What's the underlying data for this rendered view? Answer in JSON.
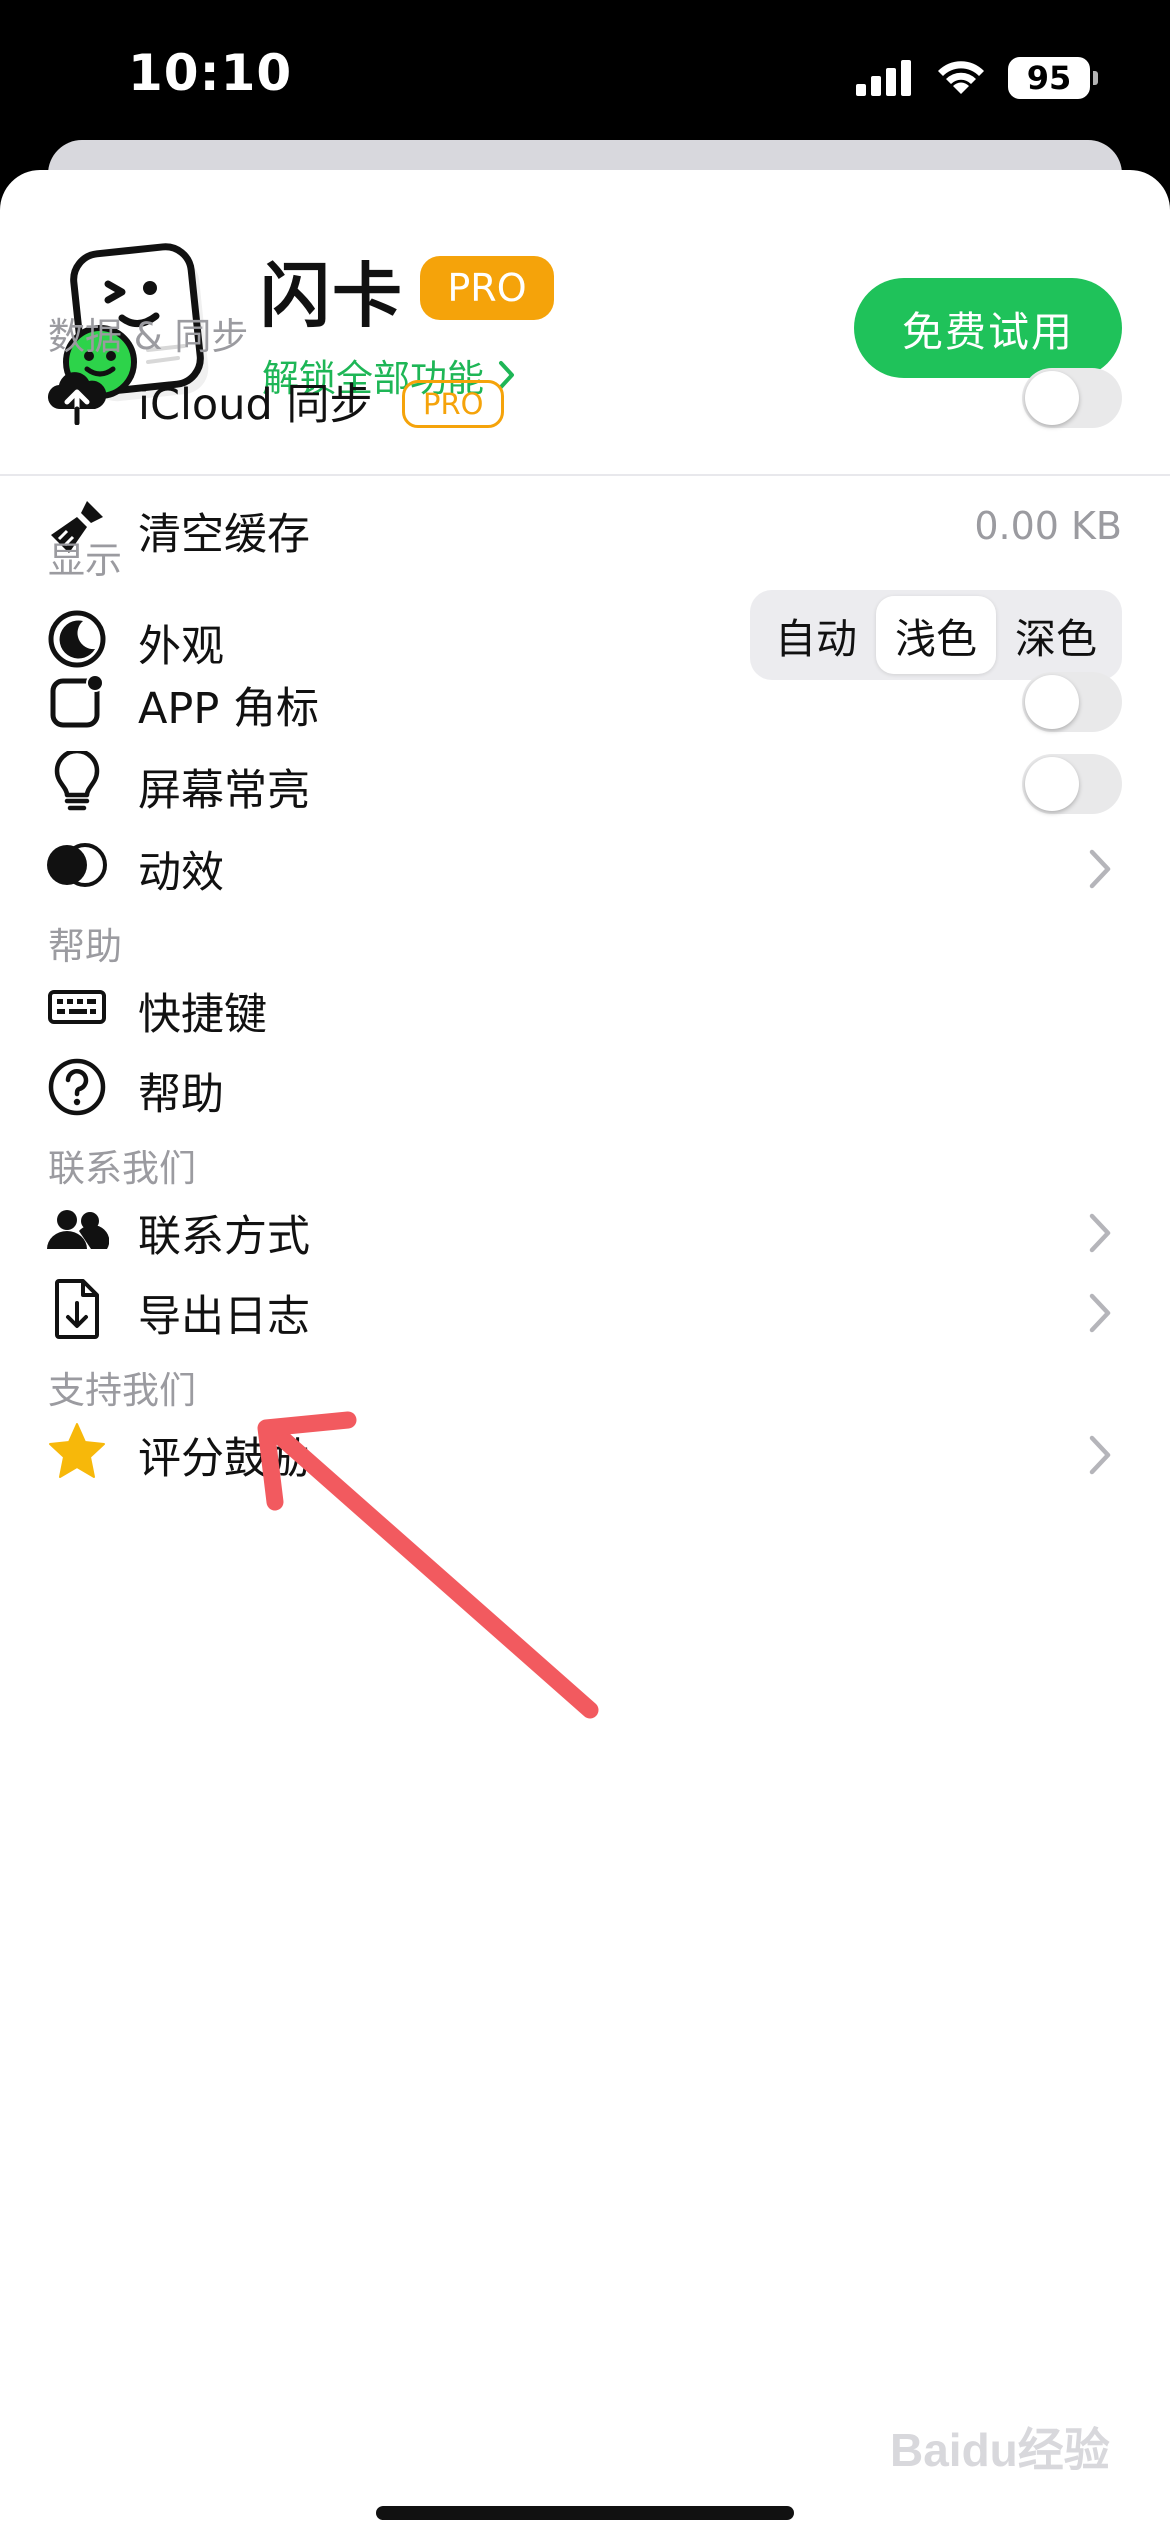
{
  "status_bar": {
    "time": "10:10",
    "battery": "95"
  },
  "header": {
    "app_name": "闪卡",
    "pro_badge": "PRO",
    "unlock_link": "解锁全部功能",
    "trial_button": "免费试用"
  },
  "sections": {
    "data_sync": {
      "title": "数据 & 同步",
      "icloud": {
        "label": "iCloud 同步",
        "badge": "PRO"
      },
      "clear_cache": {
        "label": "清空缓存",
        "value": "0.00 KB"
      }
    },
    "display": {
      "title": "显示",
      "appearance": {
        "label": "外观",
        "options": [
          "自动",
          "浅色",
          "深色"
        ],
        "selected": "浅色"
      },
      "app_badge": {
        "label": "APP 角标"
      },
      "keep_screen_on": {
        "label": "屏幕常亮"
      },
      "animation": {
        "label": "动效"
      }
    },
    "help": {
      "title": "帮助",
      "shortcuts": {
        "label": "快捷键"
      },
      "help": {
        "label": "帮助"
      }
    },
    "contact": {
      "title": "联系我们",
      "contact_methods": {
        "label": "联系方式"
      },
      "export_logs": {
        "label": "导出日志"
      }
    },
    "support": {
      "title": "支持我们",
      "rate": {
        "label": "评分鼓励"
      }
    }
  },
  "watermark": "Baidu经验",
  "colors": {
    "accent_green": "#1fc25a",
    "pro_orange": "#f5a30a",
    "annotation_red": "#f25a5f"
  }
}
